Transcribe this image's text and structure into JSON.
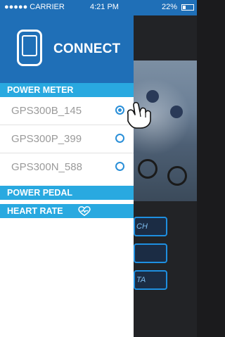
{
  "status_bar": {
    "carrier": "●●●●● CARRIER",
    "time": "4:21 PM",
    "battery": "22%"
  },
  "drawer": {
    "brand": "CONNECT",
    "sections": {
      "power_meter": "POWER METER",
      "power_pedal": "POWER PEDAL",
      "heart_rate": "HEART RATE"
    },
    "devices": [
      {
        "label": "GPS300B_145",
        "selected": true
      },
      {
        "label": "GPS300P_399",
        "selected": false
      },
      {
        "label": "GPS300N_588",
        "selected": false
      }
    ]
  },
  "background_buttons": [
    "CH",
    "",
    "TA"
  ],
  "colors": {
    "primary": "#1f6fb7",
    "section": "#29a9e0",
    "radio": "#2a8fd8",
    "bg_button_border": "#1e8fe0"
  },
  "icons": [
    "wifi-icon",
    "bluetooth-icon",
    "battery-icon",
    "device-icon",
    "tap-hand-icon",
    "heart-rate-icon"
  ]
}
